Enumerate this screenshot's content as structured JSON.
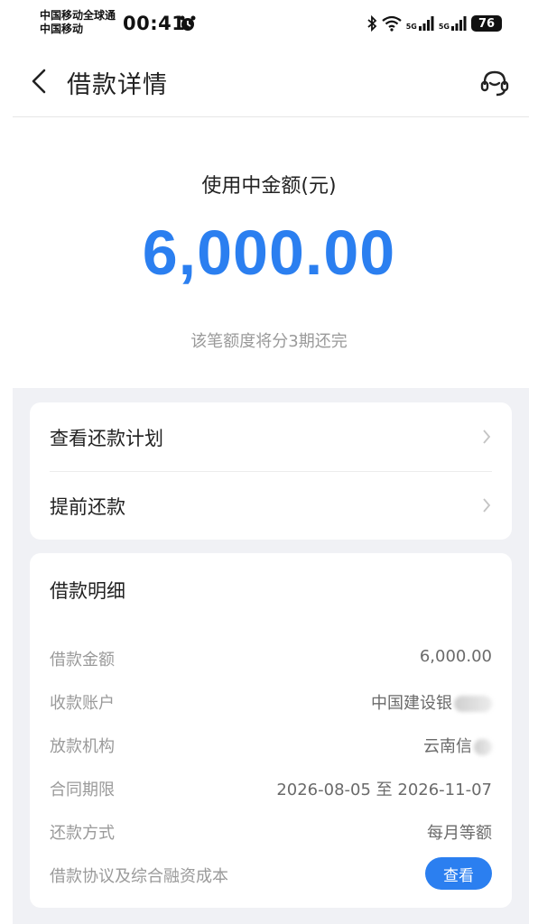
{
  "status_bar": {
    "carrier_line1": "中国移动全球通",
    "carrier_line2": "中国移动",
    "time": "00:41",
    "net1": "5G",
    "net2": "5G",
    "battery": "76"
  },
  "nav": {
    "title": "借款详情"
  },
  "hero": {
    "label": "使用中金额(元)",
    "amount": "6,000.00",
    "note": "该笔额度将分3期还完",
    "accent_color": "#2b7ff0"
  },
  "actions": [
    {
      "label": "查看还款计划"
    },
    {
      "label": "提前还款"
    }
  ],
  "details": {
    "title": "借款明细",
    "rows": [
      {
        "key": "借款金额",
        "value": "6,000.00"
      },
      {
        "key": "收款账户",
        "value": "中国建设银"
      },
      {
        "key": "放款机构",
        "value": "云南信"
      },
      {
        "key": "合同期限",
        "value": "2026-08-05 至 2026-11-07"
      },
      {
        "key": "还款方式",
        "value": "每月等额"
      },
      {
        "key": "借款协议及综合融资成本",
        "value": ""
      }
    ],
    "view_button": "查看"
  }
}
